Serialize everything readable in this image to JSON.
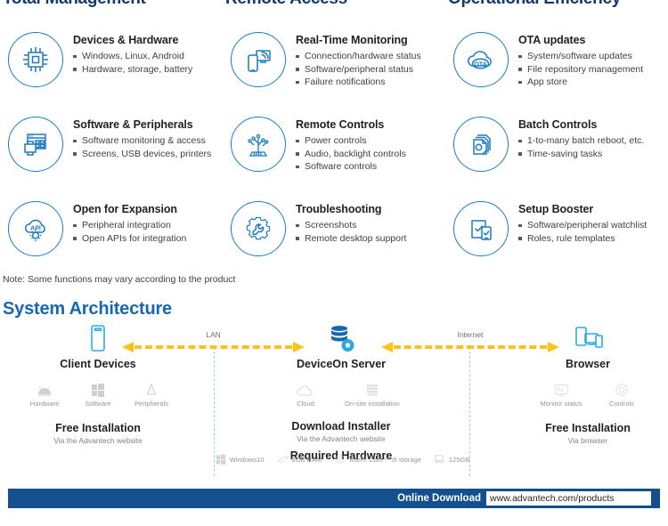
{
  "columns": [
    {
      "title": "Total Management"
    },
    {
      "title": "Remote Access"
    },
    {
      "title": "Operational Efficiency"
    }
  ],
  "features": [
    [
      {
        "icon": "chip-icon",
        "title": "Devices & Hardware",
        "bullets": [
          "Windows, Linux, Android",
          "Hardware, storage, battery"
        ]
      },
      {
        "icon": "realtime-monitor-icon",
        "title": "Real-Time Monitoring",
        "bullets": [
          "Connection/hardware status",
          "Software/peripheral status",
          "Failure notifications"
        ]
      },
      {
        "icon": "ota-cloud-icon",
        "title": "OTA updates",
        "bullets": [
          "System/software updates",
          "File repository management",
          "App store"
        ]
      }
    ],
    [
      {
        "icon": "software-peripherals-icon",
        "title": "Software & Peripherals",
        "bullets": [
          "Software monitoring & access",
          "Screens, USB devices, printers"
        ]
      },
      {
        "icon": "remote-controls-icon",
        "title": "Remote Controls",
        "bullets": [
          "Power controls",
          "Audio, backlight controls",
          "Software controls"
        ]
      },
      {
        "icon": "batch-documents-icon",
        "title": "Batch Controls",
        "bullets": [
          "1-to-many batch reboot, etc.",
          "Time-saving tasks"
        ]
      }
    ],
    [
      {
        "icon": "api-cloud-gear-icon",
        "title": "Open for Expansion",
        "bullets": [
          "Peripheral integration",
          "Open APIs for integration"
        ]
      },
      {
        "icon": "gear-wrench-icon",
        "title": "Troubleshooting",
        "bullets": [
          "Screenshots",
          "Remote desktop support"
        ]
      },
      {
        "icon": "checklist-devices-icon",
        "title": "Setup Booster",
        "bullets": [
          "Software/peripheral watchlist",
          "Roles, rule templates"
        ]
      }
    ]
  ],
  "note": "Note: Some functions may vary according to the product",
  "architecture": {
    "title": "System Architecture",
    "arrows": [
      {
        "label": "LAN"
      },
      {
        "label": "Internet"
      }
    ],
    "nodes": [
      {
        "icon": "tablet-device-icon",
        "name": "Client Devices",
        "sub": [
          {
            "icon": "android-hardware-icon",
            "label": "Hardware"
          },
          {
            "icon": "windows-software-icon",
            "label": "Software"
          },
          {
            "icon": "peripherals-icon",
            "label": "Peripherals"
          }
        ],
        "install": {
          "title": "Free Installation",
          "subtitle": "Via the Advantech website"
        }
      },
      {
        "icon": "server-database-gear-icon",
        "name": "DeviceOn Server",
        "sub": [
          {
            "icon": "cloud-icon",
            "label": "Cloud"
          },
          {
            "icon": "onsite-server-icon",
            "label": "On-site installation"
          }
        ],
        "install": {
          "title": "Download Installer",
          "subtitle": "Via the Advantech website"
        },
        "hardware_title": "Required Hardware",
        "hardware": [
          {
            "icon": "windows-logo-icon",
            "label": "Windows10"
          },
          {
            "icon": "ram-stick-icon",
            "label": "8GB RAM"
          },
          {
            "icon": "cpu-icon",
            "label": "Intel® Core™ i5 storage"
          },
          {
            "icon": "disk-drive-icon",
            "label": "125GB"
          }
        ]
      },
      {
        "icon": "multi-device-browser-icon",
        "name": "Browser",
        "sub": [
          {
            "icon": "monitor-status-icon",
            "label": "Monitor status"
          },
          {
            "icon": "controls-gear-icon",
            "label": "Controls"
          }
        ],
        "install": {
          "title": "Free Installation",
          "subtitle": "Via browser"
        }
      }
    ]
  },
  "footer": {
    "download_label": "Online Download",
    "url": "www.advantech.com/products"
  },
  "colors": {
    "brand_blue": "#1668b3",
    "dark_blue": "#133a6b",
    "footer_blue": "#14508f",
    "icon_blue": "#1c7cc1",
    "arrow_yellow": "#fcc21b",
    "divider_blue": "#9ec7e8"
  }
}
